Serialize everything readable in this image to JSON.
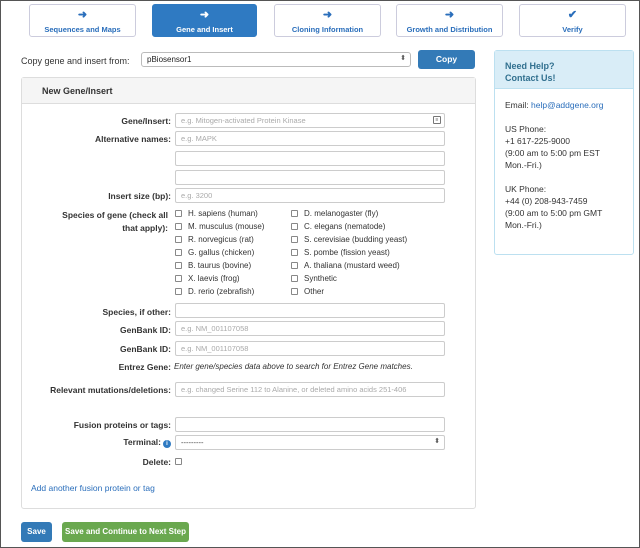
{
  "steps": [
    {
      "label": "Sequences and Maps",
      "icon": "arrow-right-icon",
      "active": false
    },
    {
      "label": "Gene and Insert",
      "icon": "arrow-right-icon",
      "active": true
    },
    {
      "label": "Cloning Information",
      "icon": "arrow-right-icon",
      "active": false
    },
    {
      "label": "Growth and Distribution",
      "icon": "arrow-right-icon",
      "active": false
    },
    {
      "label": "Verify",
      "icon": "checkmark-icon",
      "active": false
    }
  ],
  "copy": {
    "label": "Copy gene and insert from:",
    "selected": "pBiosensor1",
    "button": "Copy"
  },
  "panel": {
    "title": "New Gene/Insert",
    "gene_label": "Gene/Insert:",
    "gene_placeholder": "e.g. Mitogen-activated Protein Kinase",
    "alt_label": "Alternative names:",
    "alt_placeholder": "e.g. MAPK",
    "insert_size_label": "Insert size (bp):",
    "insert_size_placeholder": "e.g. 3200",
    "species_label": "Species of gene (check all that apply):",
    "species_col1": [
      "H. sapiens (human)",
      "M. musculus (mouse)",
      "R. norvegicus (rat)",
      "G. gallus (chicken)",
      "B. taurus (bovine)",
      "X. laevis (frog)",
      "D. rerio (zebrafish)"
    ],
    "species_col2": [
      "D. melanogaster (fly)",
      "C. elegans (nematode)",
      "S. cerevisiae (budding yeast)",
      "S. pombe (fission yeast)",
      "A. thaliana (mustard weed)",
      "Synthetic",
      "Other"
    ],
    "species_other_label": "Species, if other:",
    "genbank_label": "GenBank ID:",
    "genbank_placeholder": "e.g. NM_001107058",
    "entrez_label": "Entrez Gene:",
    "entrez_text": "Enter gene/species data above to search for Entrez Gene matches.",
    "mutations_label": "Relevant mutations/deletions:",
    "mutations_placeholder": "e.g. changed Serine 112 to Alanine, or deleted amino acids 251-406",
    "fusion_label": "Fusion proteins or tags:",
    "terminal_label": "Terminal:",
    "terminal_value": "---------",
    "delete_label": "Delete:",
    "add_link": "Add another fusion protein or tag"
  },
  "buttons": {
    "save": "Save",
    "continue": "Save and Continue to Next Step"
  },
  "help": {
    "title_line1": "Need Help?",
    "title_line2": "Contact Us!",
    "email_label": "Email:",
    "email": "help@addgene.org",
    "us_phone_label": "US Phone:",
    "us_phone": "+1 617-225-9000",
    "us_hours": "(9:00 am to 5:00 pm EST",
    "us_days": "Mon.-Fri.)",
    "uk_phone_label": "UK Phone:",
    "uk_phone": "+44 (0) 208-943-7459",
    "uk_hours": "(9:00 am to 5:00 pm GMT",
    "uk_days": "Mon.-Fri.)"
  }
}
